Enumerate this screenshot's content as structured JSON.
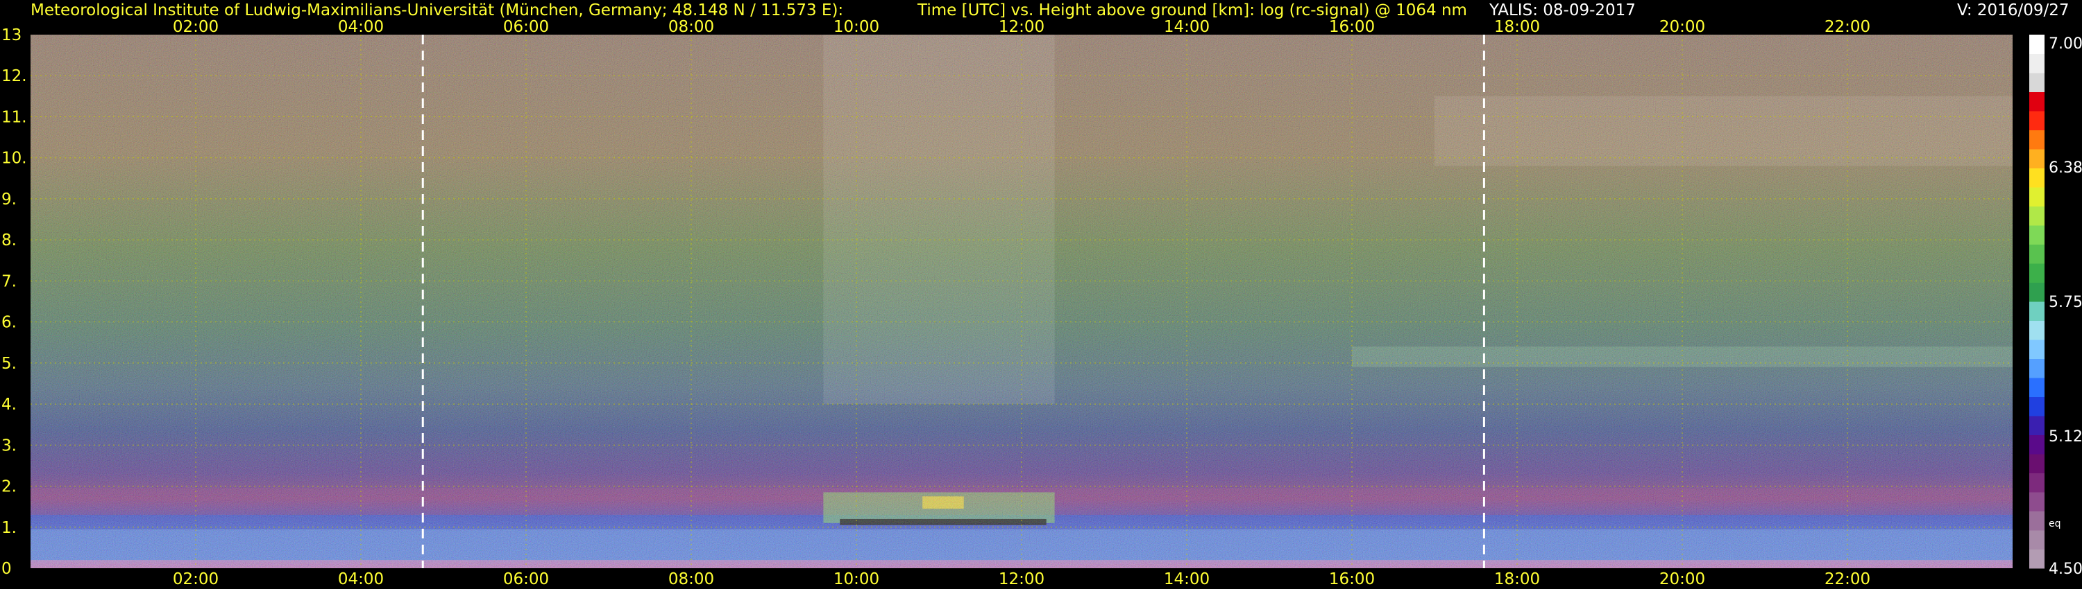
{
  "header": {
    "institute": "Meteorological Institute of Ludwig-Maximilians-Universität (München, Germany; 48.148 N / 11.573 E):",
    "plot_title": "Time [UTC] vs. Height above ground [km]: log (rc-signal) @ 1064 nm",
    "instrument_date": "YALIS: 08-09-2017",
    "version": "V: 2016/09/27"
  },
  "colors": {
    "header_text": "#ffff33",
    "grid": "#c8c800",
    "marker": "#ffffff"
  },
  "chart_data": {
    "type": "heatmap",
    "xlabel": "Time [UTC]",
    "ylabel": "Height above ground [km]",
    "x_range_hours": [
      0,
      24
    ],
    "x_ticks": [
      "02:00",
      "04:00",
      "06:00",
      "08:00",
      "10:00",
      "12:00",
      "14:00",
      "16:00",
      "18:00",
      "20:00",
      "22:00"
    ],
    "x_tick_hours": [
      2,
      4,
      6,
      8,
      10,
      12,
      14,
      16,
      18,
      20,
      22
    ],
    "ylim": [
      0,
      13
    ],
    "y_ticks": [
      "0",
      "1.",
      "2.",
      "3.",
      "4.",
      "5.",
      "6.",
      "7.",
      "8.",
      "9.",
      "10.",
      "11.",
      "12.",
      "13"
    ],
    "y_tick_values": [
      0,
      1,
      2,
      3,
      4,
      5,
      6,
      7,
      8,
      9,
      10,
      11,
      12,
      13
    ],
    "grid": true,
    "markers_hours": [
      4.75,
      17.6
    ],
    "colorbar": {
      "range": [
        4.5,
        7.0
      ],
      "tick_labels": [
        "7.00",
        "6.38",
        "5.75",
        "5.12",
        "eq",
        "4.50"
      ],
      "tick_values": [
        7.0,
        6.38,
        5.75,
        5.12,
        4.72,
        4.5
      ],
      "colors": [
        "#b39cb3",
        "#a88aa8",
        "#9b6f9b",
        "#8e4c8e",
        "#7d2a7d",
        "#6a0f70",
        "#5a0a8a",
        "#3a1fb0",
        "#2040e0",
        "#2a70ff",
        "#55a0ff",
        "#80c8ff",
        "#a0e0f0",
        "#6fd0c0",
        "#2fa04f",
        "#3cb04a",
        "#59c24f",
        "#7ed957",
        "#b0e848",
        "#e0f030",
        "#ffe020",
        "#ffb020",
        "#ff7a10",
        "#ff2a10",
        "#e00010",
        "#d8d8d8",
        "#eeeeee",
        "#ffffff"
      ]
    }
  }
}
